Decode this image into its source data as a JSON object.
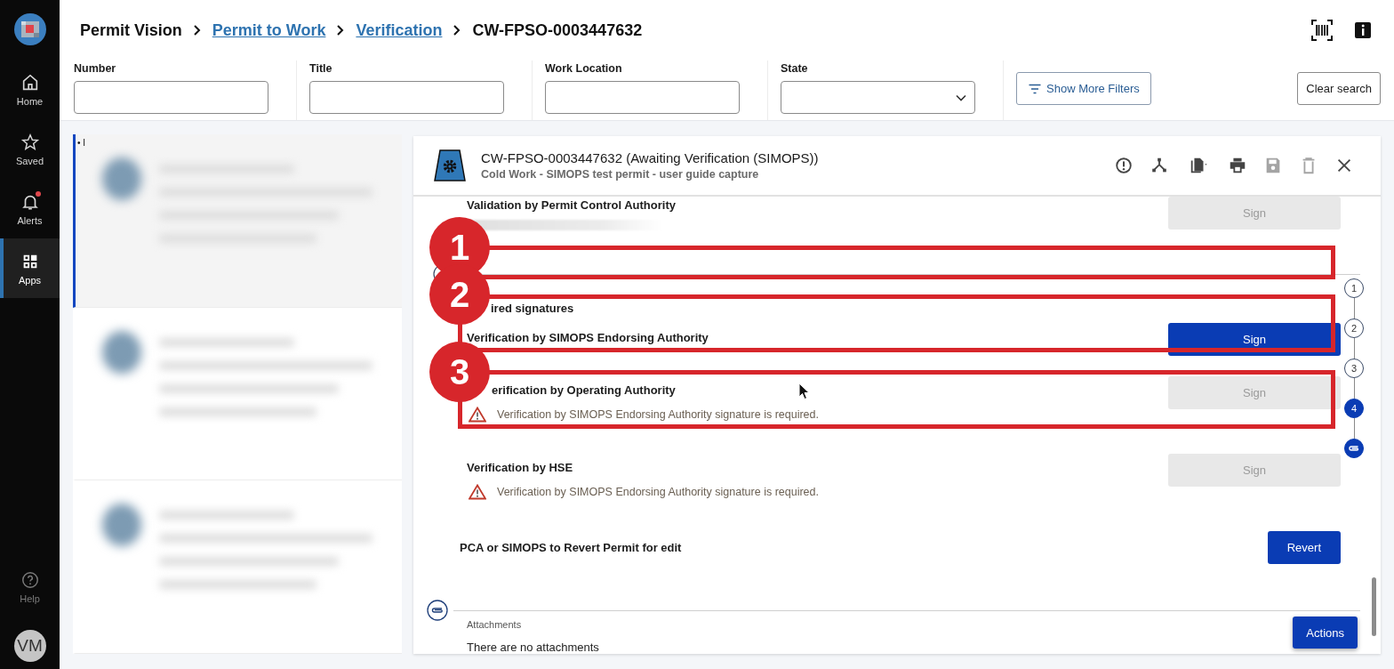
{
  "nav": {
    "items": [
      {
        "label": "Home",
        "kind": "home",
        "selected": false,
        "badge": false
      },
      {
        "label": "Saved",
        "kind": "star",
        "selected": false,
        "badge": false
      },
      {
        "label": "Alerts",
        "kind": "bell",
        "selected": false,
        "badge": true
      },
      {
        "label": "Apps",
        "kind": "apps",
        "selected": true,
        "badge": false
      }
    ],
    "help": "Help",
    "avatar": "VM"
  },
  "breadcrumb": [
    {
      "label": "Permit Vision",
      "kind": "root"
    },
    {
      "label": "Permit to Work",
      "kind": "link"
    },
    {
      "label": "Verification",
      "kind": "link"
    },
    {
      "label": "CW-FPSO-0003447632",
      "kind": "current"
    }
  ],
  "filters": [
    {
      "label": "Number",
      "kind": "text"
    },
    {
      "label": "Title",
      "kind": "text"
    },
    {
      "label": "Work Location",
      "kind": "text"
    },
    {
      "label": "State",
      "kind": "select"
    }
  ],
  "show_more_filters": "Show More Filters",
  "clear_search": "Clear search",
  "list": {
    "marker": "• I",
    "items": [
      {
        "selected": true
      },
      {
        "selected": false
      },
      {
        "selected": false
      }
    ]
  },
  "permit": {
    "title": "CW-FPSO-0003447632 (Awaiting Verification (SIMOPS))",
    "subtitle": "Cold Work - SIMOPS test permit - user guide capture",
    "tools": [
      {
        "kind": "alert",
        "disabled": false
      },
      {
        "kind": "fork",
        "disabled": false
      },
      {
        "kind": "copy",
        "disabled": false
      },
      {
        "kind": "print",
        "disabled": false
      },
      {
        "kind": "save",
        "disabled": true
      },
      {
        "kind": "delete",
        "disabled": true
      },
      {
        "kind": "close",
        "disabled": false
      }
    ],
    "validation": {
      "label": "Validation by Permit Control Authority",
      "button": "Sign",
      "disabled": true
    },
    "required_heading": "ired signatures",
    "signatures": [
      {
        "label": "Verification by SIMOPS Endorsing Authority",
        "button": "Sign",
        "disabled": false
      },
      {
        "label": "erification by Operating Authority",
        "button": "Sign",
        "disabled": true,
        "warning": "Verification by SIMOPS Endorsing Authority signature is required."
      },
      {
        "label": "Verification by HSE",
        "button": "Sign",
        "disabled": true,
        "warning": "Verification by SIMOPS Endorsing Authority signature is required."
      }
    ],
    "revert": {
      "label": "PCA or SIMOPS to Revert Permit for edit",
      "button": "Revert"
    },
    "attachments": {
      "heading": "Attachments",
      "empty": "There are no attachments"
    },
    "actions": "Actions",
    "stepper": [
      {
        "label": "1",
        "kind": "number",
        "selected": false
      },
      {
        "label": "2",
        "kind": "number",
        "selected": false
      },
      {
        "label": "3",
        "kind": "number",
        "selected": false
      },
      {
        "label": "4",
        "kind": "number",
        "selected": true
      },
      {
        "kind": "attachment",
        "selected": true
      }
    ]
  },
  "callouts": [
    {
      "number": "1"
    },
    {
      "number": "2"
    },
    {
      "number": "3"
    }
  ]
}
